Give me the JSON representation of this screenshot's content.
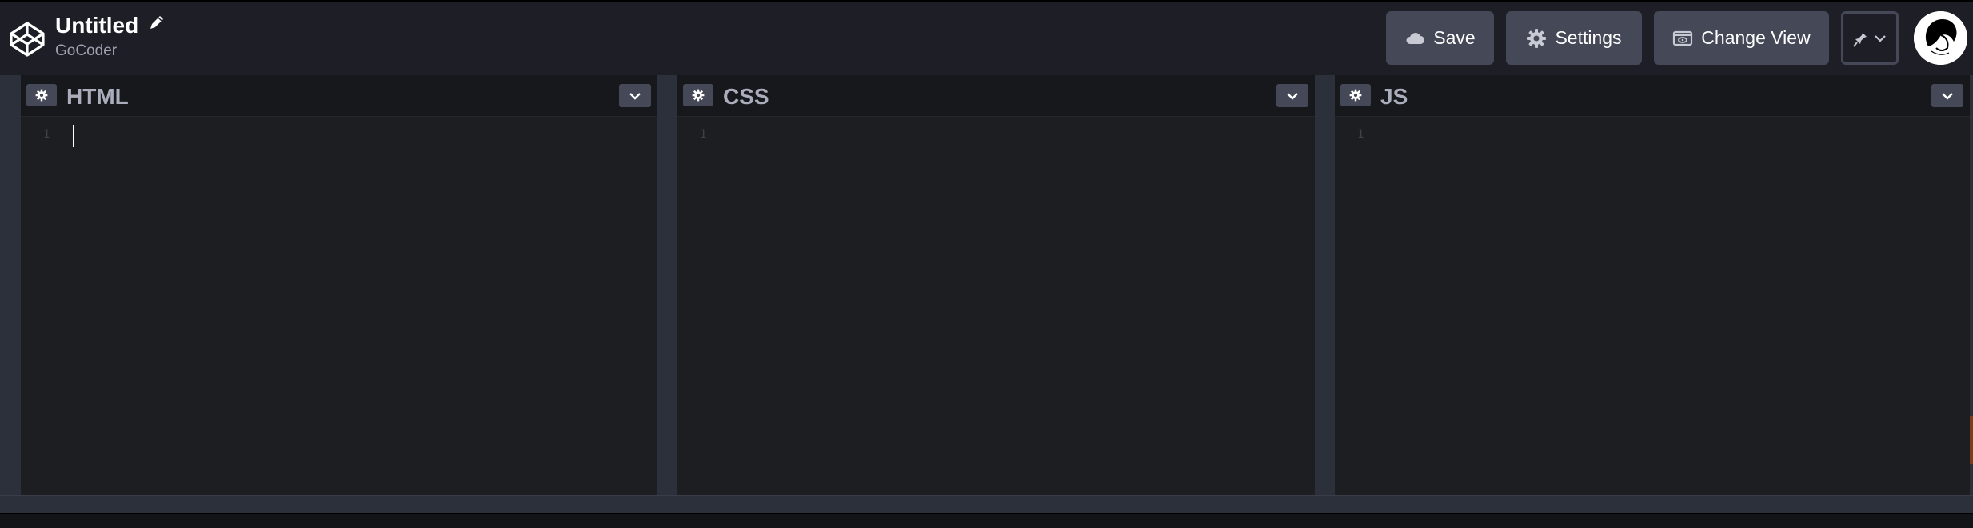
{
  "header": {
    "title": "Untitled",
    "owner": "GoCoder",
    "buttons": {
      "save": "Save",
      "settings": "Settings",
      "change_view": "Change View"
    }
  },
  "panes": [
    {
      "title": "HTML",
      "line_numbers": [
        "1"
      ]
    },
    {
      "title": "CSS",
      "line_numbers": [
        "1"
      ]
    },
    {
      "title": "JS",
      "line_numbers": [
        "1"
      ]
    }
  ],
  "icons": {
    "logo": "codepen-logo-icon",
    "edit": "pencil-icon",
    "save": "cloud-icon",
    "settings": "gear-icon",
    "change_view": "layout-view-icon",
    "pin": "pin-icon",
    "collapse": "chevron-down-icon"
  },
  "colors": {
    "header_bg": "#1e1f26",
    "button_bg": "#444857",
    "editor_bg": "#1d1e22",
    "pane_title": "#aaaebc"
  }
}
